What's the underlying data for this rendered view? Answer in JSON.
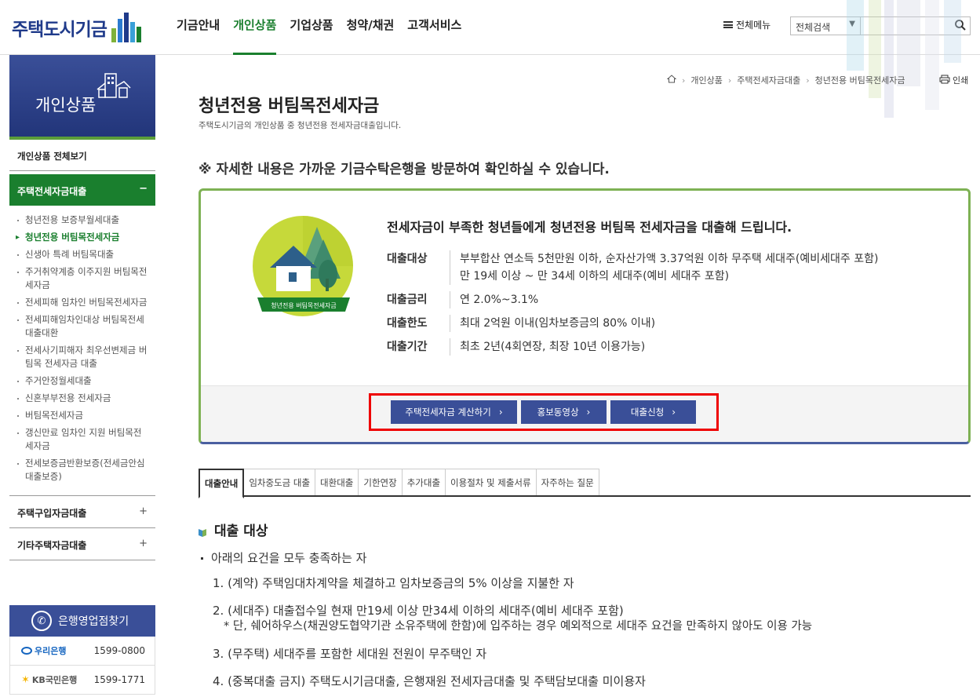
{
  "header": {
    "logo_text": "주택도시기금",
    "nav": [
      "기금안내",
      "개인상품",
      "기업상품",
      "청약/채권",
      "고객서비스"
    ],
    "nav_active": 1,
    "all_menu": "전체메뉴",
    "search_select": "전체검색",
    "search_value": ""
  },
  "sidebar": {
    "banner_title": "개인상품",
    "all_view": "개인상품 전체보기",
    "category_open": "주택전세자금대출",
    "category_open_toggle": "−",
    "sub_items": [
      "청년전용 보증부월세대출",
      "청년전용 버팀목전세자금",
      "신생아 특례 버팀목대출",
      "주거취약계층 이주지원 버팀목전세자금",
      "전세피해 임차인 버팀목전세자금",
      "전세피해임차인대상 버팀목전세대출대환",
      "전세사기피해자 최우선변제금 버팀목 전세자금 대출",
      "주거안정월세대출",
      "신혼부부전용 전세자금",
      "버팀목전세자금",
      "갱신만료 임차인 지원 버팀목전세자금",
      "전세보증금반환보증(전세금안심대출보증)"
    ],
    "sub_active": 1,
    "category2": "주택구입자금대출",
    "category3": "기타주택자금대출",
    "toggle_plus": "+"
  },
  "bank": {
    "title": "은행영업점찾기",
    "rows": [
      {
        "name": "우리은행",
        "phone": "1599-0800"
      },
      {
        "name": "KB국민은행",
        "phone": "1599-1771"
      }
    ]
  },
  "breadcrumb": [
    "개인상품",
    "주택전세자금대출",
    "청년전용 버팀목전세자금"
  ],
  "print_label": "인쇄",
  "page": {
    "title": "청년전용 버팀목전세자금",
    "subtitle": "주택도시기금의 개인상품 중 청년전용 전세자금대출입니다.",
    "notice": "※ 자세한 내용은 가까운 기금수탁은행을 방문하여 확인하실 수 있습니다."
  },
  "product": {
    "emblem_label": "청년전용 버팀목전세자금",
    "headline": "전세자금이 부족한 청년들에게 청년전용 버팀목 전세자금을 대출해 드립니다.",
    "details": [
      {
        "term": "대출대상",
        "lines": [
          "부부합산 연소득 5천만원 이하, 순자산가액 3.37억원 이하 무주택 세대주(예비세대주 포함)",
          "만 19세 이상 ~ 만 34세 이하의 세대주(예비 세대주 포함)"
        ]
      },
      {
        "term": "대출금리",
        "lines": [
          "연 2.0%~3.1%"
        ]
      },
      {
        "term": "대출한도",
        "lines": [
          "최대 2억원 이내(임차보증금의 80% 이내)"
        ]
      },
      {
        "term": "대출기간",
        "lines": [
          "최초 2년(4회연장, 최장 10년 이용가능)"
        ]
      }
    ],
    "buttons": [
      "주택전세자금 계산하기",
      "홍보동영상",
      "대출신청"
    ]
  },
  "tabs": [
    "대출안내",
    "임차중도금 대출",
    "대환대출",
    "기한연장",
    "추가대출",
    "이용절차 및 제출서류",
    "자주하는 질문"
  ],
  "tab_active": 0,
  "section": {
    "title": "대출 대상",
    "lead": "아래의 요건을 모두 충족하는 자",
    "items": [
      "1. (계약) 주택임대차계약을 체결하고 임차보증금의 5% 이상을 지불한 자",
      "2. (세대주) 대출접수일 현재 만19세 이상 만34세 이하의 세대주(예비 세대주 포함)",
      "3. (무주택) 세대주를 포함한 세대원 전원이 무주택인 자",
      "4. (중복대출 금지) 주택도시기금대출, 은행재원 전세자금대출 및 주택담보대출 미이용자"
    ],
    "item2_note": "* 단, 쉐어하우스(채권양도협약기관 소유주택에 한함)에 입주하는 경우 예외적으로 세대주 요건을 만족하지 않아도 이용 가능"
  },
  "colors": {
    "brand_green": "#1a7f2e",
    "brand_navy": "#3a4f98",
    "highlight_red": "#e00000"
  }
}
